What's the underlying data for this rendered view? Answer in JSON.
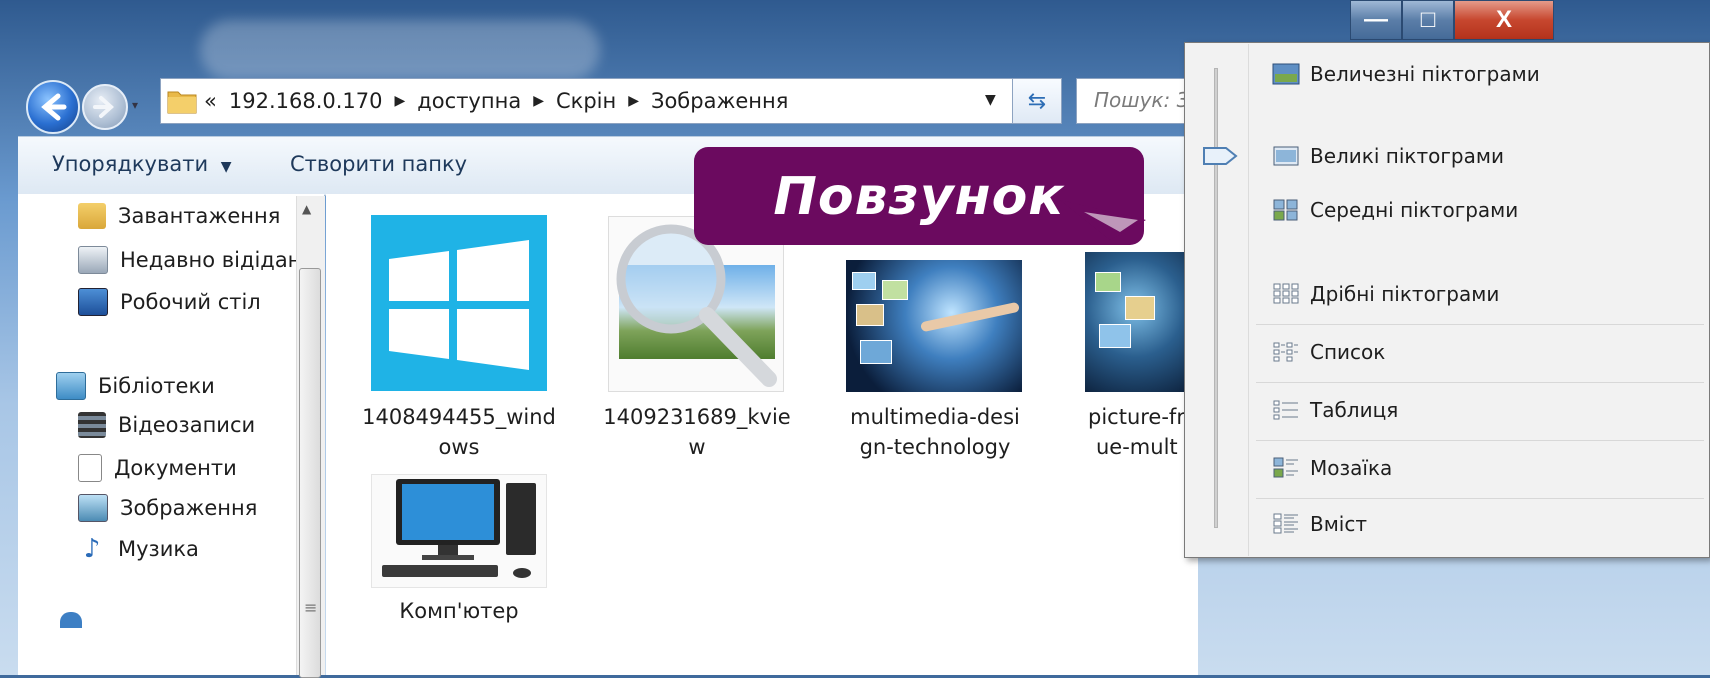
{
  "window": {
    "caption_buttons": {
      "minimize": "—",
      "maximize": "□",
      "close": "X"
    }
  },
  "address": {
    "overflow": "«",
    "crumbs": [
      "192.168.0.170",
      "доступна",
      "Скрін",
      "Зображення"
    ]
  },
  "search": {
    "placeholder": "Пошук: З"
  },
  "toolbar": {
    "organize": "Упорядкувати",
    "new_folder": "Створити папку"
  },
  "nav": {
    "favorites": [
      "Завантаження",
      "Недавно відідан",
      "Робочий стіл"
    ],
    "libraries_header": "Бібліотеки",
    "libraries": [
      "Відеозаписи",
      "Документи",
      "Зображення",
      "Музика"
    ]
  },
  "files": [
    {
      "name_l1": "1408494455_wind",
      "name_l2": "ows"
    },
    {
      "name_l1": "1409231689_kvie",
      "name_l2": "w"
    },
    {
      "name_l1": "multimedia-desi",
      "name_l2": "gn-technology"
    },
    {
      "name_l1": "picture-fr",
      "name_l2": "ue-mult"
    },
    {
      "name_l1": "Комп'ютер",
      "name_l2": ""
    }
  ],
  "callout": {
    "text": "Повзунок"
  },
  "view_menu": {
    "items": [
      "Величезні піктограми",
      "Великі піктограми",
      "Середні піктограми",
      "Дрібні піктограми",
      "Список",
      "Таблиця",
      "Мозаїка",
      "Вміст"
    ]
  },
  "colors": {
    "callout_bg": "#6b0a5f",
    "win_blue": "#1ea8e4",
    "accent": "#2d6db5"
  }
}
